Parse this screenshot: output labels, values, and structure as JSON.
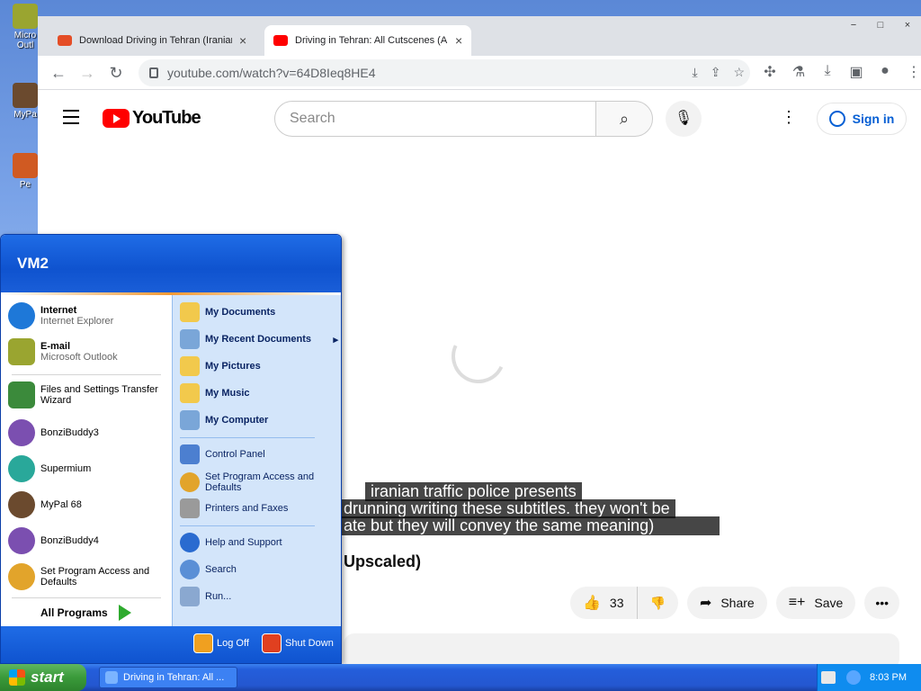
{
  "desktop": {
    "icons": [
      {
        "label": "Micro Outl",
        "color": "#9aa530"
      },
      {
        "label": "MyPa",
        "color": "#6b4a2e"
      },
      {
        "label": "Pe",
        "color": "#d05a22"
      }
    ]
  },
  "browser": {
    "tabs": [
      {
        "title": "Download Driving in Tehran (Iranian",
        "close": "×",
        "favicon_color": "#e44d26"
      },
      {
        "title": "Driving in Tehran: All Cutscenes (AI",
        "close": "×",
        "favicon_color": "#ff0000"
      }
    ],
    "url": "youtube.com/watch?v=64D8Ieq8HE4",
    "window_controls": [
      "−",
      "□",
      "×"
    ]
  },
  "youtube": {
    "logo_text": "YouTube",
    "search_placeholder": "Search",
    "signin_label": "Sign in",
    "captions": [
      "iranian traffic police presents",
      "drunning writing these subtitles. they won't be",
      "ate but they will convey the same meaning)"
    ],
    "video_title_fragment": "Upscaled)",
    "like_count": "33",
    "share_label": "Share",
    "save_label": "Save"
  },
  "start_menu": {
    "user": "VM2",
    "pinned": [
      {
        "main": "Internet",
        "sub": "Internet Explorer",
        "color": "#1e78d8"
      },
      {
        "main": "E-mail",
        "sub": "Microsoft Outlook",
        "color": "#9aa530"
      }
    ],
    "recent": [
      {
        "label": "Files and Settings Transfer Wizard",
        "color": "#3b8a3b"
      },
      {
        "label": "BonziBuddy3",
        "color": "#7b4fb0"
      },
      {
        "label": "Supermium",
        "color": "#29a89a"
      },
      {
        "label": "MyPal 68",
        "color": "#6b4a2e"
      },
      {
        "label": "BonziBuddy4",
        "color": "#7b4fb0"
      },
      {
        "label": "Set Program Access and Defaults",
        "color": "#e2a42b"
      }
    ],
    "all_programs": "All Programs",
    "right_top": [
      {
        "label": "My Documents",
        "color": "#f2c94c"
      },
      {
        "label": "My Recent Documents",
        "color": "#7aa6d8",
        "arrow": "▸"
      },
      {
        "label": "My Pictures",
        "color": "#f2c94c"
      },
      {
        "label": "My Music",
        "color": "#f2c94c"
      },
      {
        "label": "My Computer",
        "color": "#7aa6d8"
      }
    ],
    "right_mid": [
      {
        "label": "Control Panel",
        "color": "#4c7fd0"
      },
      {
        "label": "Set Program Access and Defaults",
        "color": "#e2a42b"
      },
      {
        "label": "Printers and Faxes",
        "color": "#9a9a9a"
      }
    ],
    "right_bottom": [
      {
        "label": "Help and Support",
        "color": "#2a6bd0"
      },
      {
        "label": "Search",
        "color": "#5a8fd6"
      },
      {
        "label": "Run...",
        "color": "#8aa8d0"
      }
    ],
    "log_off": "Log Off",
    "shut_down": "Shut Down"
  },
  "taskbar": {
    "start_label": "start",
    "task_title": "Driving in Tehran: All ...",
    "clock": "8:03 PM"
  }
}
